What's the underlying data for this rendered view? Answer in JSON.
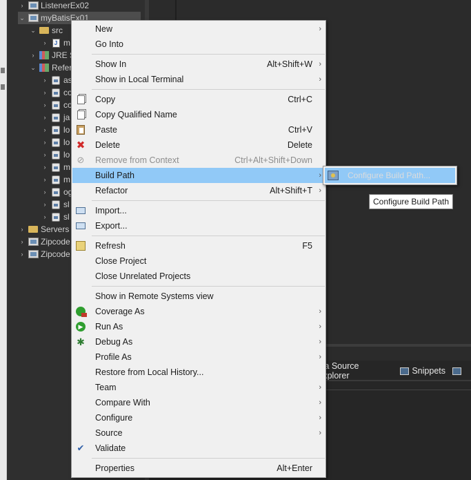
{
  "explorer": {
    "rows": [
      {
        "label": "ListenerEx02",
        "arrow": ">",
        "icon": "project-icon"
      },
      {
        "label": "myBatisEx01",
        "arrow": "v",
        "icon": "project-icon"
      },
      {
        "label": "src",
        "arrow": "v",
        "icon": "folder-icon"
      },
      {
        "label": "m",
        "arrow": ">",
        "icon": "java-package-icon"
      },
      {
        "label": "JRE S",
        "arrow": ">",
        "icon": "library-icon"
      },
      {
        "label": "Refer",
        "arrow": "v",
        "icon": "library-icon"
      },
      {
        "label": "as",
        "arrow": ">",
        "icon": "jar-icon"
      },
      {
        "label": "co",
        "arrow": ">",
        "icon": "jar-icon"
      },
      {
        "label": "co",
        "arrow": ">",
        "icon": "jar-icon"
      },
      {
        "label": "ja",
        "arrow": ">",
        "icon": "jar-icon"
      },
      {
        "label": "lo",
        "arrow": ">",
        "icon": "jar-icon"
      },
      {
        "label": "lo",
        "arrow": ">",
        "icon": "jar-icon"
      },
      {
        "label": "lo",
        "arrow": ">",
        "icon": "jar-icon"
      },
      {
        "label": "m",
        "arrow": ">",
        "icon": "jar-icon"
      },
      {
        "label": "m",
        "arrow": ">",
        "icon": "jar-icon"
      },
      {
        "label": "og",
        "arrow": ">",
        "icon": "jar-icon"
      },
      {
        "label": "sl",
        "arrow": ">",
        "icon": "jar-icon"
      },
      {
        "label": "sl",
        "arrow": ">",
        "icon": "jar-icon"
      },
      {
        "label": "Servers",
        "arrow": ">",
        "icon": "folder-icon"
      },
      {
        "label": "Zipcode",
        "arrow": ">",
        "icon": "project-icon"
      },
      {
        "label": "Zipcode",
        "arrow": ">",
        "icon": "project-icon"
      }
    ]
  },
  "context_menu": {
    "items": [
      {
        "label": "New",
        "shortcut": "",
        "submenu": true,
        "icon": ""
      },
      {
        "label": "Go Into",
        "shortcut": "",
        "submenu": false,
        "icon": ""
      },
      {
        "label": "Show In",
        "shortcut": "Alt+Shift+W",
        "submenu": true,
        "icon": ""
      },
      {
        "label": "Show in Local Terminal",
        "shortcut": "",
        "submenu": true,
        "icon": ""
      },
      {
        "label": "Copy",
        "shortcut": "Ctrl+C",
        "submenu": false,
        "icon": "copy-icon"
      },
      {
        "label": "Copy Qualified Name",
        "shortcut": "",
        "submenu": false,
        "icon": "copy-qualified-name-icon"
      },
      {
        "label": "Paste",
        "shortcut": "Ctrl+V",
        "submenu": false,
        "icon": "paste-icon"
      },
      {
        "label": "Delete",
        "shortcut": "Delete",
        "submenu": false,
        "icon": "delete-icon"
      },
      {
        "label": "Remove from Context",
        "shortcut": "Ctrl+Alt+Shift+Down",
        "submenu": false,
        "icon": "remove-from-context-icon",
        "disabled": true
      },
      {
        "label": "Build Path",
        "shortcut": "",
        "submenu": true,
        "icon": "",
        "highlighted": true
      },
      {
        "label": "Refactor",
        "shortcut": "Alt+Shift+T",
        "submenu": true,
        "icon": ""
      },
      {
        "label": "Import...",
        "shortcut": "",
        "submenu": false,
        "icon": "import-icon"
      },
      {
        "label": "Export...",
        "shortcut": "",
        "submenu": false,
        "icon": "export-icon"
      },
      {
        "label": "Refresh",
        "shortcut": "F5",
        "submenu": false,
        "icon": "refresh-icon"
      },
      {
        "label": "Close Project",
        "shortcut": "",
        "submenu": false,
        "icon": ""
      },
      {
        "label": "Close Unrelated Projects",
        "shortcut": "",
        "submenu": false,
        "icon": ""
      },
      {
        "label": "Show in Remote Systems view",
        "shortcut": "",
        "submenu": false,
        "icon": ""
      },
      {
        "label": "Coverage As",
        "shortcut": "",
        "submenu": true,
        "icon": "coverage-icon"
      },
      {
        "label": "Run As",
        "shortcut": "",
        "submenu": true,
        "icon": "run-icon"
      },
      {
        "label": "Debug As",
        "shortcut": "",
        "submenu": true,
        "icon": "debug-icon"
      },
      {
        "label": "Profile As",
        "shortcut": "",
        "submenu": true,
        "icon": ""
      },
      {
        "label": "Restore from Local History...",
        "shortcut": "",
        "submenu": false,
        "icon": ""
      },
      {
        "label": "Team",
        "shortcut": "",
        "submenu": true,
        "icon": ""
      },
      {
        "label": "Compare With",
        "shortcut": "",
        "submenu": true,
        "icon": ""
      },
      {
        "label": "Configure",
        "shortcut": "",
        "submenu": true,
        "icon": ""
      },
      {
        "label": "Source",
        "shortcut": "",
        "submenu": true,
        "icon": ""
      },
      {
        "label": "Validate",
        "shortcut": "",
        "submenu": false,
        "icon": "checkmark-icon"
      },
      {
        "label": "Properties",
        "shortcut": "Alt+Enter",
        "submenu": false,
        "icon": ""
      }
    ]
  },
  "submenu": {
    "item_label": "Configure Build Path...",
    "icon": "configure-build-path-icon"
  },
  "tooltip": {
    "text": "Configure Build Path"
  },
  "bottom_panel": {
    "tabs": [
      {
        "label": "ata Source Explorer",
        "icon": "data-source-explorer-icon"
      },
      {
        "label": "Snippets",
        "icon": "snippets-icon"
      }
    ]
  },
  "colors": {
    "menu_bg": "#f0f0f0",
    "highlight": "#91c9f7",
    "ide_bg": "#2b2b2b"
  }
}
